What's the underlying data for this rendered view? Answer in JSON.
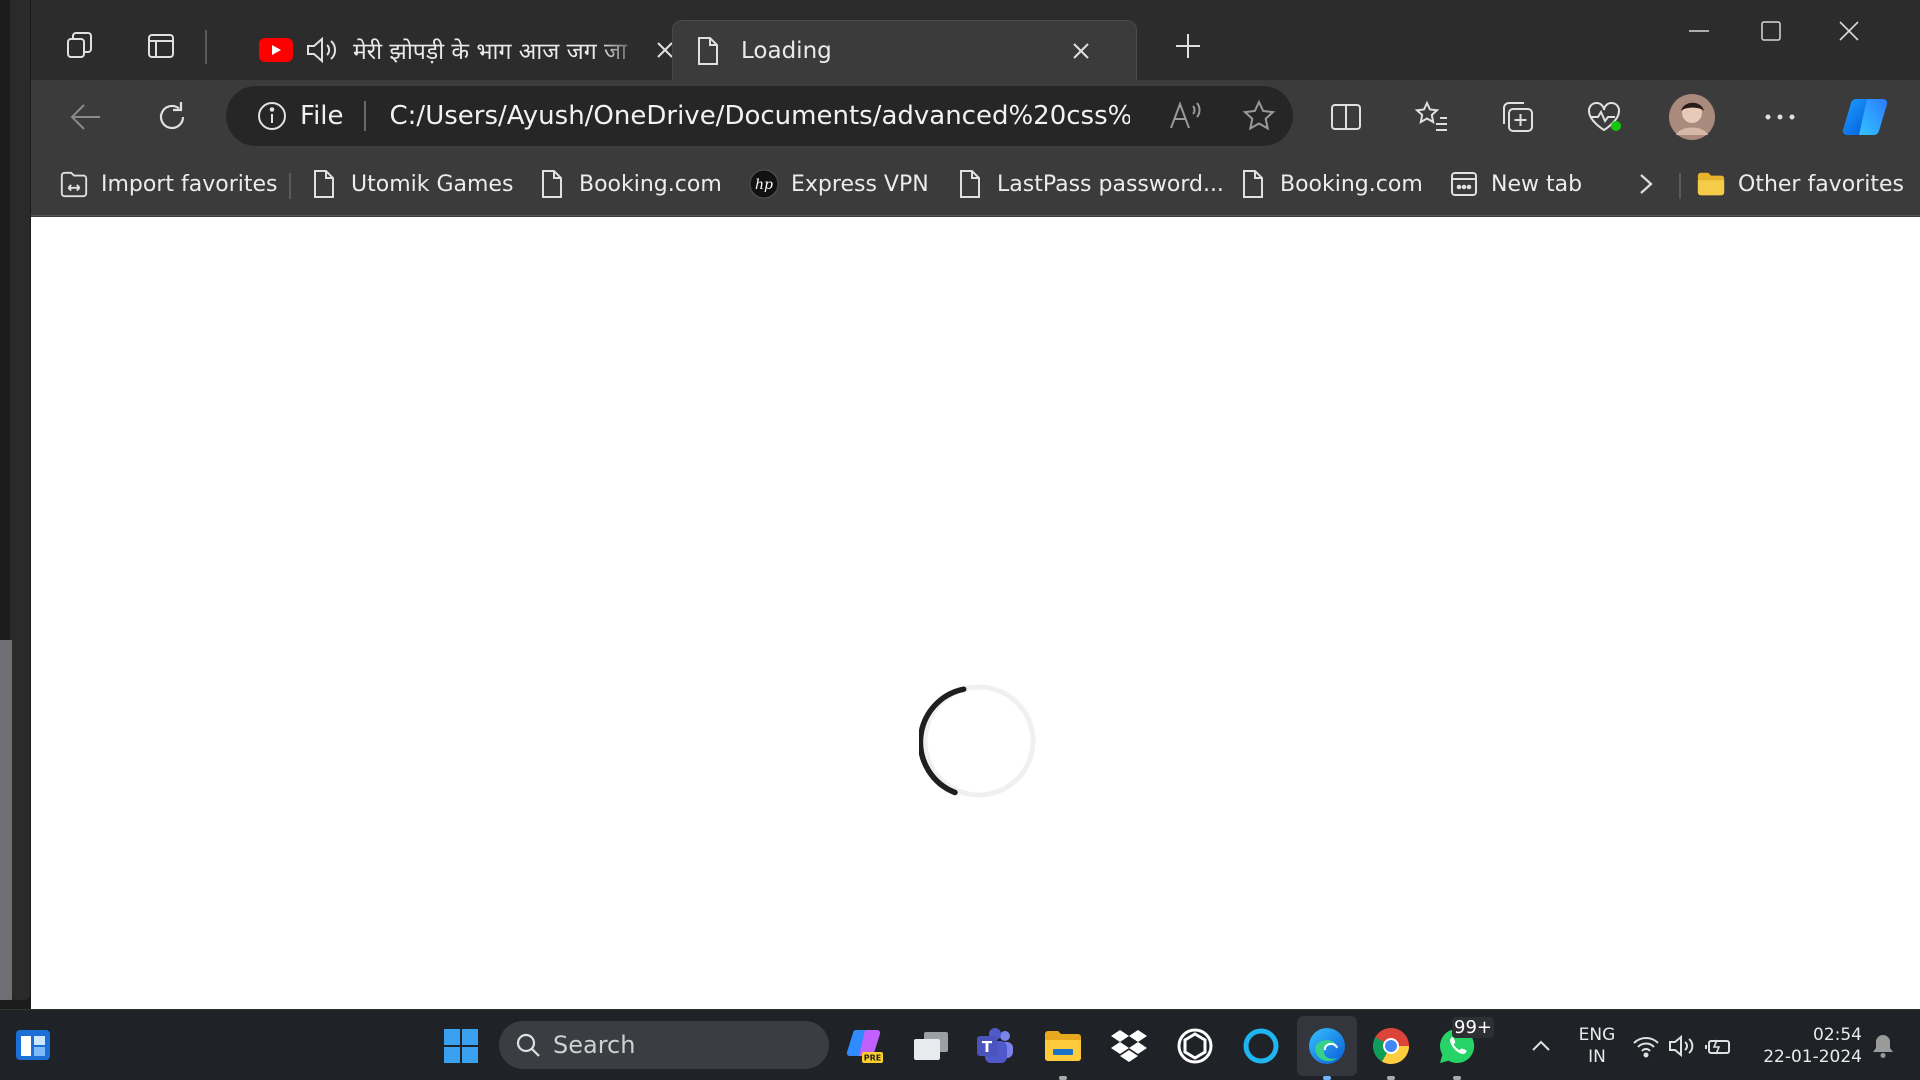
{
  "browser": {
    "tabs": [
      {
        "label": "मेरी झोपड़ी के भाग आज जग जा",
        "state": "inactive",
        "audio": true
      },
      {
        "label": "Loading",
        "state": "active"
      }
    ],
    "address": {
      "scheme_label": "File",
      "url": "C:/Users/Ayush/OneDrive/Documents/advanced%20css%2..."
    },
    "favorites": [
      {
        "label": "Import favorites",
        "icon": "import-icon"
      },
      {
        "label": "Utomik Games",
        "icon": "page-icon"
      },
      {
        "label": "Booking.com",
        "icon": "page-icon"
      },
      {
        "label": "Express VPN",
        "icon": "hp-icon"
      },
      {
        "label": "LastPass password...",
        "icon": "page-icon"
      },
      {
        "label": "Booking.com",
        "icon": "page-icon"
      },
      {
        "label": "New tab",
        "icon": "app-icon"
      }
    ],
    "other_favorites": "Other favorites"
  },
  "page": {
    "loading": true
  },
  "taskbar": {
    "search_placeholder": "Search",
    "whatsapp_badge": "99+",
    "language": "ENG",
    "region": "IN",
    "time": "02:54",
    "date": "22-01-2024"
  },
  "colors": {
    "accent": "#0078d4",
    "youtube": "#ff0000",
    "spinner": "#1f1f1f"
  }
}
